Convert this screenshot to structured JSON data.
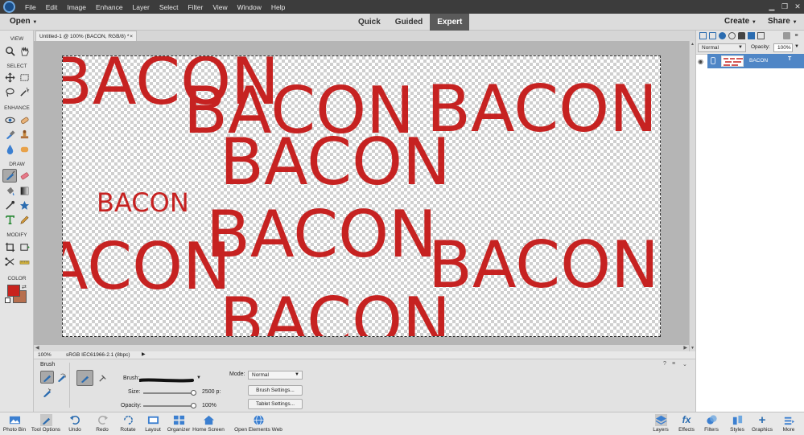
{
  "menubar": {
    "items": [
      "File",
      "Edit",
      "Image",
      "Enhance",
      "Layer",
      "Select",
      "Filter",
      "View",
      "Window",
      "Help"
    ]
  },
  "modebar": {
    "open_label": "Open",
    "modes": [
      "Quick",
      "Guided",
      "Expert"
    ],
    "active_mode": "Expert",
    "create_label": "Create",
    "share_label": "Share"
  },
  "toolbox": {
    "sections": [
      "VIEW",
      "SELECT",
      "ENHANCE",
      "DRAW",
      "MODIFY",
      "COLOR"
    ],
    "foreground_color": "#c8231e",
    "background_color": "#b76f4e"
  },
  "document": {
    "tab_title": "Untitled-1 @ 100% (BACON, RGB/8) *",
    "tab_close": "×",
    "canvas_word": "BACON",
    "text_color": "#c62221"
  },
  "status": {
    "zoom": "100%",
    "profile": "sRGB IEC61966-2.1 (8bpc)"
  },
  "tool_options": {
    "title": "Brush",
    "brush_label": "Brush:",
    "size_label": "Size:",
    "size_value": "2500 p:",
    "opacity_label": "Opacity:",
    "opacity_value": "100%",
    "mode_label": "Mode:",
    "mode_value": "Normal",
    "brush_settings": "Brush Settings...",
    "tablet_settings": "Tablet Settings..."
  },
  "layers_panel": {
    "blend_mode": "Normal",
    "opacity_label": "Opacity:",
    "opacity_value": "100%",
    "layer_name": "BACON",
    "accent_color": "#4f86c6"
  },
  "bottombar": {
    "items": [
      "Photo Bin",
      "Tool Options",
      "Undo",
      "Redo",
      "Rotate",
      "Layout",
      "Organizer",
      "Home Screen",
      "Open Elements Web",
      "Layers",
      "Effects",
      "Filters",
      "Styles",
      "Graphics",
      "More"
    ]
  }
}
